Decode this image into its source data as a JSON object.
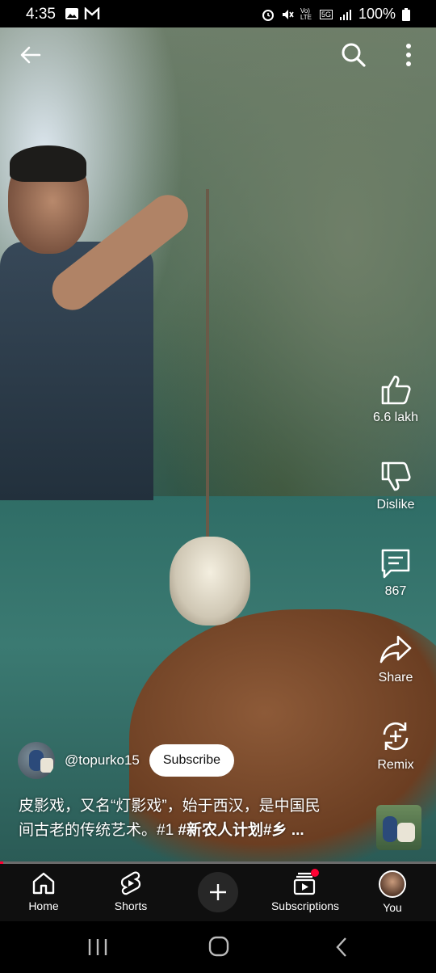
{
  "status_bar": {
    "time": "4:35",
    "lte_label": "Vo) LTE",
    "network_label": "5G",
    "battery": "100%"
  },
  "top_bar": {
    "back_icon": "arrow-left-icon",
    "search_icon": "search-icon",
    "more_icon": "more-vertical-icon"
  },
  "actions": {
    "like_count": "6.6 lakh",
    "dislike_label": "Dislike",
    "comment_count": "867",
    "share_label": "Share",
    "remix_label": "Remix"
  },
  "channel": {
    "handle": "@topurko15",
    "subscribe_label": "Subscribe"
  },
  "caption": {
    "text_line1": "皮影戏，又名“灯影戏”，始于西汉，是中国民",
    "text_line2": "间古老的传统艺术。#1 ",
    "hashtags": "#新农人计划#乡 ..."
  },
  "progress": {
    "played_fraction": 0.008,
    "fill_color": "#ff0033"
  },
  "bottom_nav": {
    "home": "Home",
    "shorts": "Shorts",
    "subscriptions": "Subscriptions",
    "you": "You",
    "notification_dot_color": "#ff0033"
  },
  "system_nav": {
    "recents_icon": "recents-icon",
    "home_icon": "home-circle-icon",
    "back_icon": "chevron-left-icon"
  }
}
